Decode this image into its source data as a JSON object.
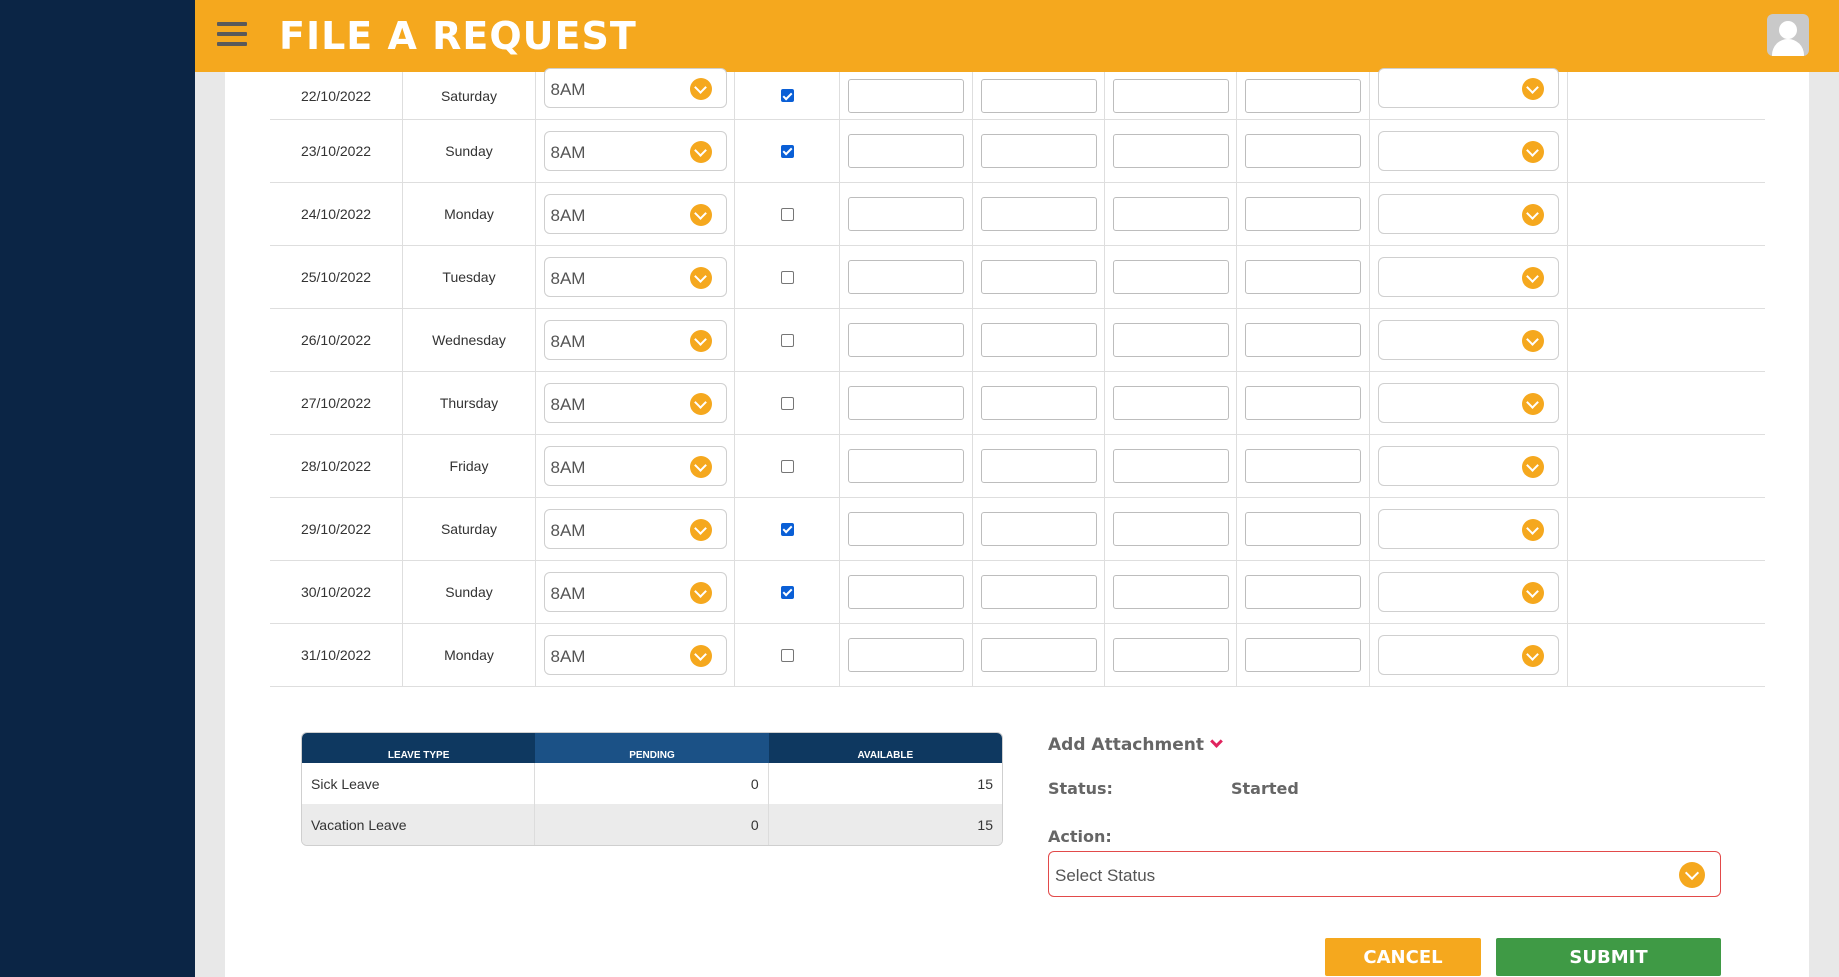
{
  "header": {
    "title": "FILE A REQUEST",
    "menu_icon": "hamburger-menu-icon",
    "avatar_icon": "user-avatar-icon"
  },
  "colors": {
    "sidebar": "#0b2545",
    "accent": "#f5a81e",
    "submit": "#3f9a45",
    "error_border": "#e24a4a"
  },
  "schedule": {
    "rows": [
      {
        "date": "22/10/2022",
        "day": "Saturday",
        "time": "8AM",
        "checked": true
      },
      {
        "date": "23/10/2022",
        "day": "Sunday",
        "time": "8AM",
        "checked": true
      },
      {
        "date": "24/10/2022",
        "day": "Monday",
        "time": "8AM",
        "checked": false
      },
      {
        "date": "25/10/2022",
        "day": "Tuesday",
        "time": "8AM",
        "checked": false
      },
      {
        "date": "26/10/2022",
        "day": "Wednesday",
        "time": "8AM",
        "checked": false
      },
      {
        "date": "27/10/2022",
        "day": "Thursday",
        "time": "8AM",
        "checked": false
      },
      {
        "date": "28/10/2022",
        "day": "Friday",
        "time": "8AM",
        "checked": false
      },
      {
        "date": "29/10/2022",
        "day": "Saturday",
        "time": "8AM",
        "checked": true
      },
      {
        "date": "30/10/2022",
        "day": "Sunday",
        "time": "8AM",
        "checked": true
      },
      {
        "date": "31/10/2022",
        "day": "Monday",
        "time": "8AM",
        "checked": false
      }
    ]
  },
  "leave_table": {
    "headers": [
      "LEAVE TYPE",
      "PENDING",
      "AVAILABLE"
    ],
    "rows": [
      {
        "type": "Sick Leave",
        "pending": "0",
        "available": "15"
      },
      {
        "type": "Vacation Leave",
        "pending": "0",
        "available": "15"
      }
    ]
  },
  "form": {
    "add_attachment": "Add Attachment",
    "status_label": "Status:",
    "status_value": "Started",
    "action_label": "Action:",
    "action_placeholder": "Select Status",
    "cancel": "CANCEL",
    "submit": "SUBMIT"
  }
}
